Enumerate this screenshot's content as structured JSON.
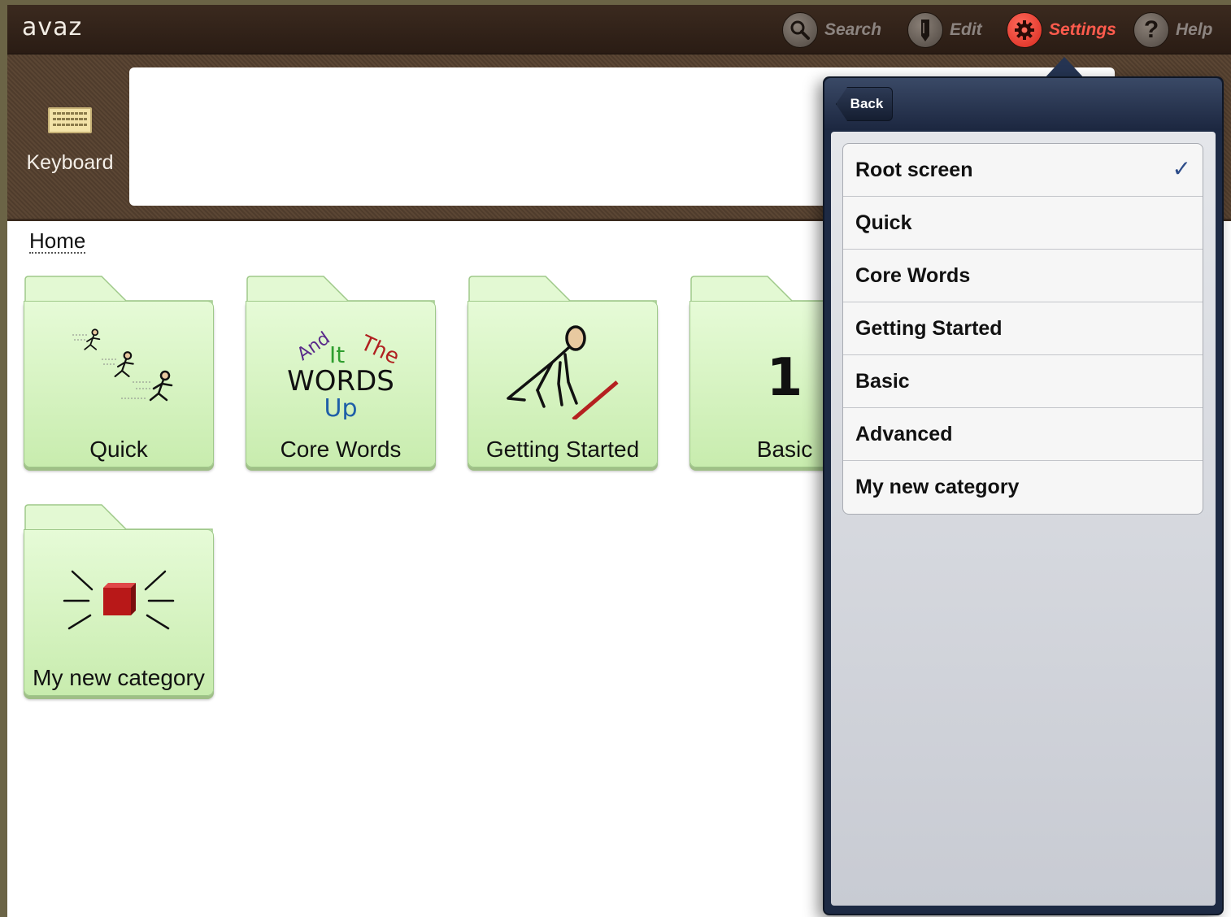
{
  "app": {
    "logo": "avaz"
  },
  "toolbar": {
    "search_label": "Search",
    "edit_label": "Edit",
    "settings_label": "Settings",
    "help_label": "Help"
  },
  "keyboard": {
    "label": "Keyboard"
  },
  "breadcrumb": {
    "label": "Home"
  },
  "tiles": [
    {
      "label": "Quick"
    },
    {
      "label": "Core Words",
      "art_words": [
        "And",
        "It",
        "The",
        "WORDS",
        "Up"
      ]
    },
    {
      "label": "Getting Started"
    },
    {
      "label": "Basic",
      "art_text": "1"
    },
    {
      "label": "My new category"
    }
  ],
  "popover": {
    "back_label": "Back",
    "items": [
      {
        "label": "Root screen",
        "checked": true
      },
      {
        "label": "Quick"
      },
      {
        "label": "Core Words"
      },
      {
        "label": "Getting Started"
      },
      {
        "label": "Basic"
      },
      {
        "label": "Advanced"
      },
      {
        "label": "My new category"
      }
    ],
    "check_glyph": "✓"
  },
  "colors": {
    "topbar": "#2f2018",
    "accent": "#ff5b4d",
    "tile_green": "#d6f3c2",
    "popover_frame": "#1d2a44"
  }
}
